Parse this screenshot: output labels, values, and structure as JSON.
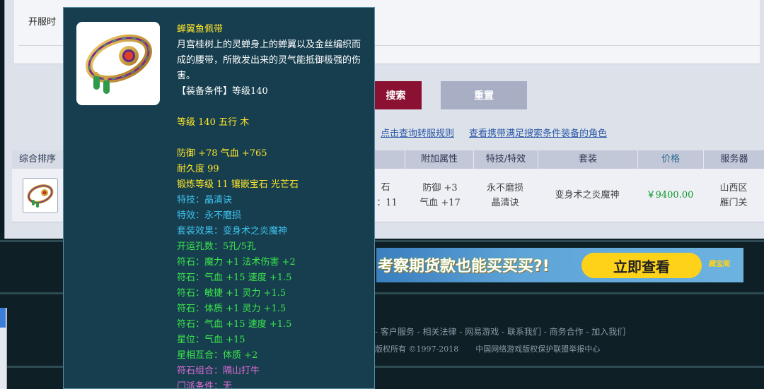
{
  "filter": {
    "open_label": "开服时",
    "search_button": "搜索",
    "reset_button": "重置",
    "link_transfer_rules": "点击查询转服规则",
    "link_view_roles": "查看携带满足搜索条件装备的角色"
  },
  "table": {
    "headers": [
      "综合排序",
      "附加属性",
      "特技/特效",
      "套装",
      "价格",
      "服务器"
    ],
    "row": {
      "partial_left_1": "石",
      "partial_left_2": "：11",
      "extra_attr_1": "防御 +3",
      "extra_attr_2": "气血 +17",
      "skill_1": "永不磨损",
      "skill_2": "晶清诀",
      "set": "变身术之炎魔神",
      "price": "￥9400.00",
      "server_1": "山西区",
      "server_2": "雁门关"
    }
  },
  "banner": {
    "text": "考察期货款也能买买买?!",
    "button": "立即查看",
    "logo": "藏宝阁"
  },
  "footer": {
    "links": "- 客户服务 - 相关法律 - 网易游戏 - 联系我们 - 商务合作 - 加入我们",
    "copyright": "版权所有 ©1997-2018",
    "report": "中国网络游戏版权保护联盟举报中心"
  },
  "tooltip": {
    "name": "蝉翼鱼佩带",
    "description": "月宫桂树上的灵蝉身上的蝉翼以及金丝编织而成的腰带，所散发出来的灵气能抵御极强的伤害。",
    "requirement": "【装备条件】等级140",
    "level": "等级 140 五行 木",
    "defense": "防御 +78 气血 +765",
    "durability": "耐久度 99",
    "forge": "锻炼等级 11 镶嵌宝石 光芒石",
    "skill": "特技：晶清诀",
    "effect": "特效：永不磨损",
    "set_effect": "套装效果：变身术之炎魔神",
    "holes": "开运孔数：5孔/5孔",
    "runes": [
      "符石：魔力 +1 法术伤害 +2",
      "符石：气血 +15 速度 +1.5",
      "符石：敏捷 +1 灵力 +1.5",
      "符石：体质 +1 灵力 +1.5",
      "符石：气血 +15 速度 +1.5"
    ],
    "star": "星位：气血 +15",
    "star_combo": "星相互合：体质 +2",
    "rune_combo": "符石组合：隔山打牛",
    "school_req": "门派条件：无"
  },
  "colors": {
    "search_button": "#8a1131",
    "reset_button": "#a8aec4",
    "tooltip_bg": "#163e4f",
    "title_yellow": "#ffe629",
    "stat_cyan": "#3fc3ef",
    "rune_green": "#3ce64c",
    "combo_pink": "#e36cd6",
    "price_green": "#0a9a2a"
  }
}
